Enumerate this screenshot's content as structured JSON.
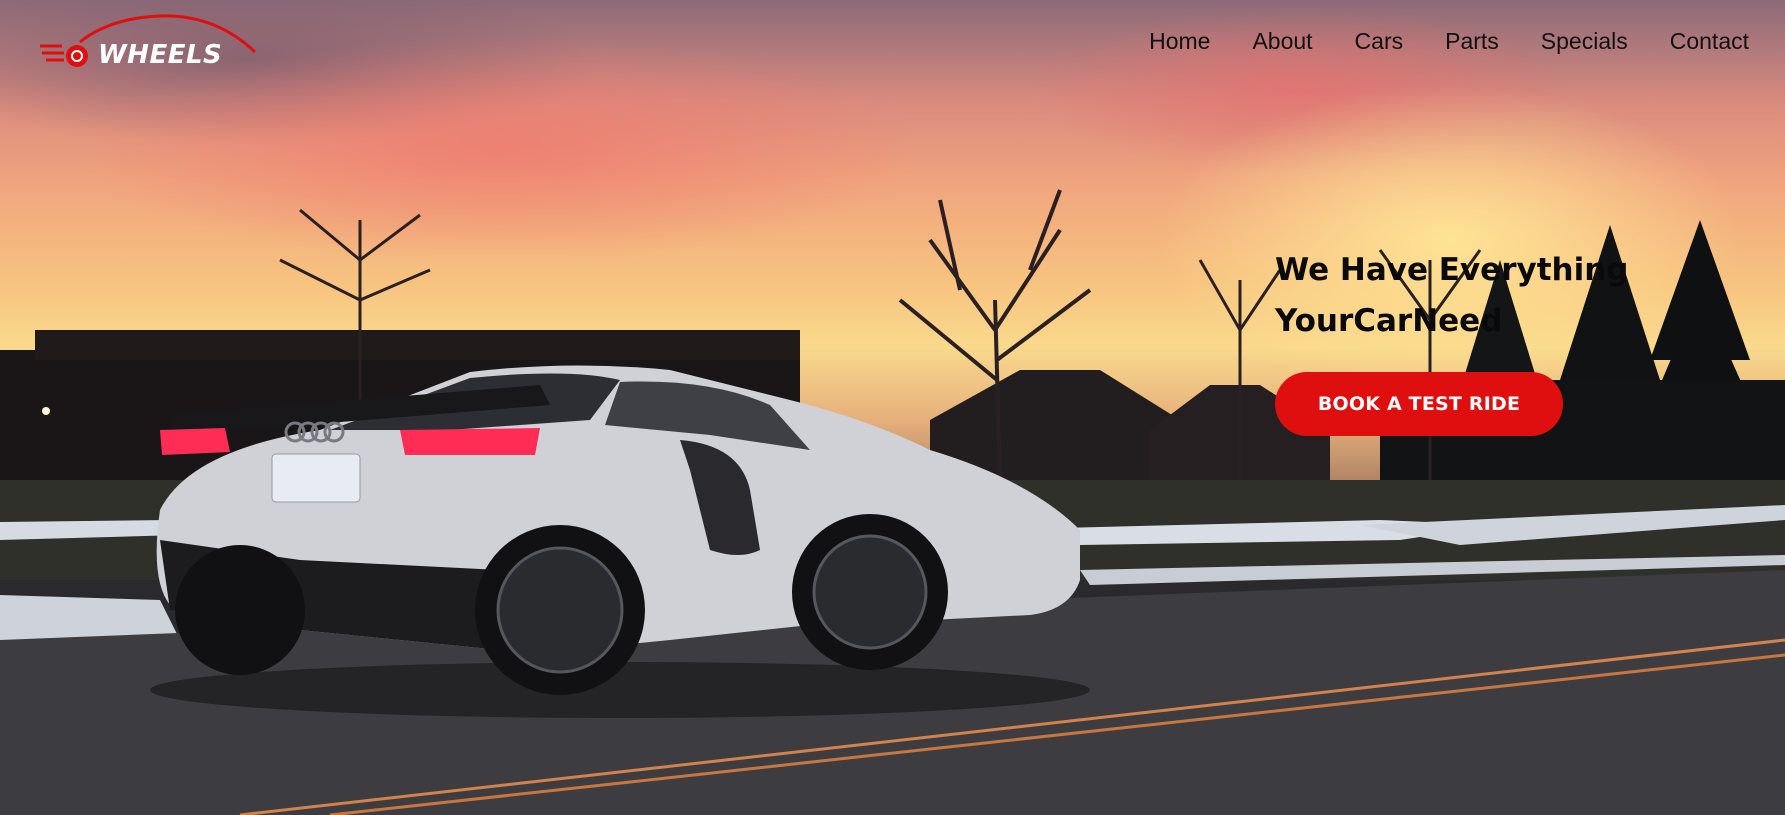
{
  "brand": {
    "name": "WHEELS",
    "logo_icon": "car-wheel-icon",
    "accent_color": "#e00f0f"
  },
  "nav": {
    "items": [
      {
        "label": "Home"
      },
      {
        "label": "About"
      },
      {
        "label": "Cars"
      },
      {
        "label": "Parts"
      },
      {
        "label": "Specials"
      },
      {
        "label": "Contact"
      }
    ]
  },
  "hero": {
    "headline_line1": "We Have Everything",
    "headline_line2": "YourCarNeed",
    "cta_label": "BOOK A TEST RIDE",
    "cta_color": "#e00f0f",
    "background_image": "white sports car on road at sunset"
  }
}
